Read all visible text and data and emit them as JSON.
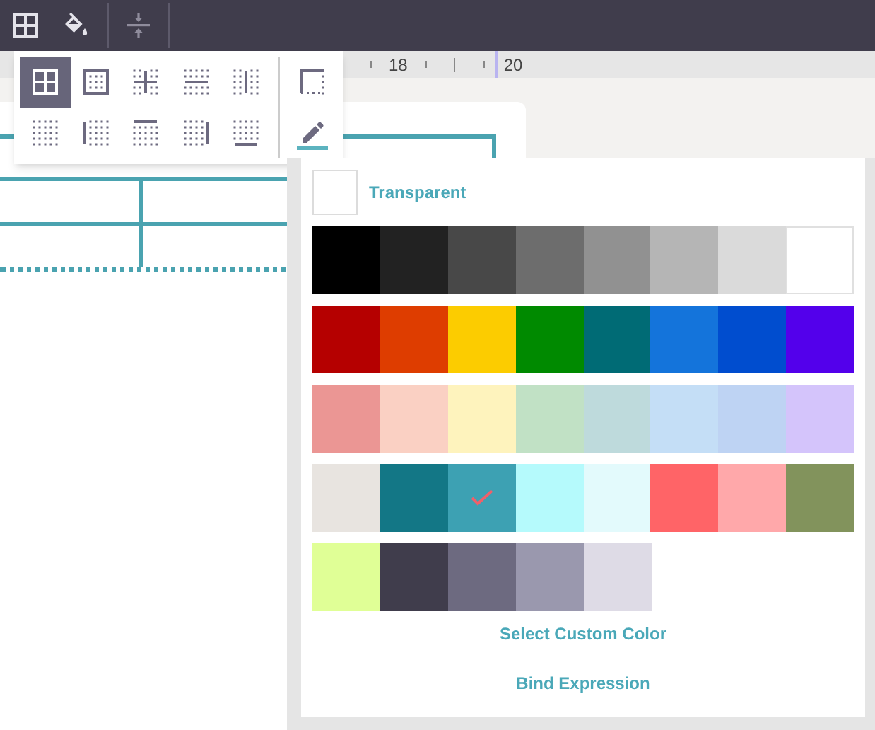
{
  "ruler": {
    "labels": [
      "18",
      "20"
    ]
  },
  "border_menu": {
    "options": [
      {
        "kind": "all",
        "selected": true
      },
      {
        "kind": "outside",
        "selected": false
      },
      {
        "kind": "inside",
        "selected": false
      },
      {
        "kind": "horizontal",
        "selected": false
      },
      {
        "kind": "vertical",
        "selected": false
      },
      {
        "kind": "none",
        "selected": false
      },
      {
        "kind": "left",
        "selected": false
      },
      {
        "kind": "top",
        "selected": false
      },
      {
        "kind": "right",
        "selected": false
      },
      {
        "kind": "bottom",
        "selected": false
      }
    ]
  },
  "color_picker": {
    "transparent_label": "Transparent",
    "colors": [
      {
        "color": "#000000",
        "selected": false
      },
      {
        "color": "#222222",
        "selected": false
      },
      {
        "color": "#484848",
        "selected": false
      },
      {
        "color": "#6d6d6d",
        "selected": false
      },
      {
        "color": "#919191",
        "selected": false
      },
      {
        "color": "#b5b5b5",
        "selected": false
      },
      {
        "color": "#dadada",
        "selected": false
      },
      {
        "color": "#ffffff",
        "selected": false
      },
      {
        "color": "#b50000",
        "selected": false
      },
      {
        "color": "#de3d00",
        "selected": false
      },
      {
        "color": "#fccc00",
        "selected": false
      },
      {
        "color": "#008a00",
        "selected": false
      },
      {
        "color": "#006b75",
        "selected": false
      },
      {
        "color": "#1474db",
        "selected": false
      },
      {
        "color": "#004dcf",
        "selected": false
      },
      {
        "color": "#5300eb",
        "selected": false
      },
      {
        "color": "#eb9694",
        "selected": false
      },
      {
        "color": "#fad0c3",
        "selected": false
      },
      {
        "color": "#fef3bd",
        "selected": false
      },
      {
        "color": "#c1e1c5",
        "selected": false
      },
      {
        "color": "#bedadc",
        "selected": false
      },
      {
        "color": "#c4def6",
        "selected": false
      },
      {
        "color": "#bed3f3",
        "selected": false
      },
      {
        "color": "#d4c4fb",
        "selected": false
      },
      {
        "color": "#e8e4e0",
        "selected": false
      },
      {
        "color": "#137786",
        "selected": false
      },
      {
        "color": "#3da1b3",
        "selected": true
      },
      {
        "color": "#b5fafc",
        "selected": false
      },
      {
        "color": "#e3fafc",
        "selected": false
      },
      {
        "color": "#ff6467",
        "selected": false
      },
      {
        "color": "#ffa8aa",
        "selected": false
      },
      {
        "color": "#82935c",
        "selected": false
      },
      {
        "color": "#e0ff96",
        "selected": false
      },
      {
        "color": "#403d4c",
        "selected": false
      },
      {
        "color": "#6d6a80",
        "selected": false
      },
      {
        "color": "#9a98ae",
        "selected": false
      },
      {
        "color": "#dedbe6",
        "selected": false
      }
    ],
    "actions": [
      "Select Custom Color",
      "Bind Expression"
    ]
  }
}
